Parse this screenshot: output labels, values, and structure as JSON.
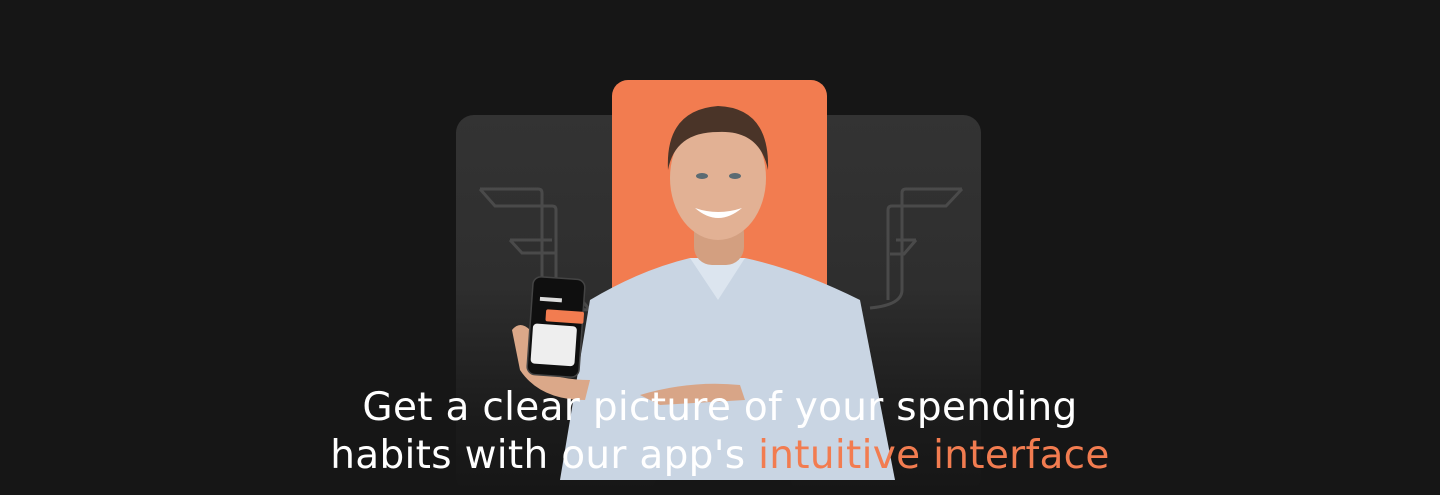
{
  "headline": {
    "line1": "Get a clear picture of your spending",
    "line2_prefix": "habits with our app's ",
    "line2_accent": "intuitive interface"
  },
  "colors": {
    "background": "#161616",
    "accent": "#f27c50",
    "card": "#333333"
  },
  "icons": [
    "brand-logo-icon-left",
    "brand-logo-icon-right",
    "smartphone-app-mockup"
  ]
}
